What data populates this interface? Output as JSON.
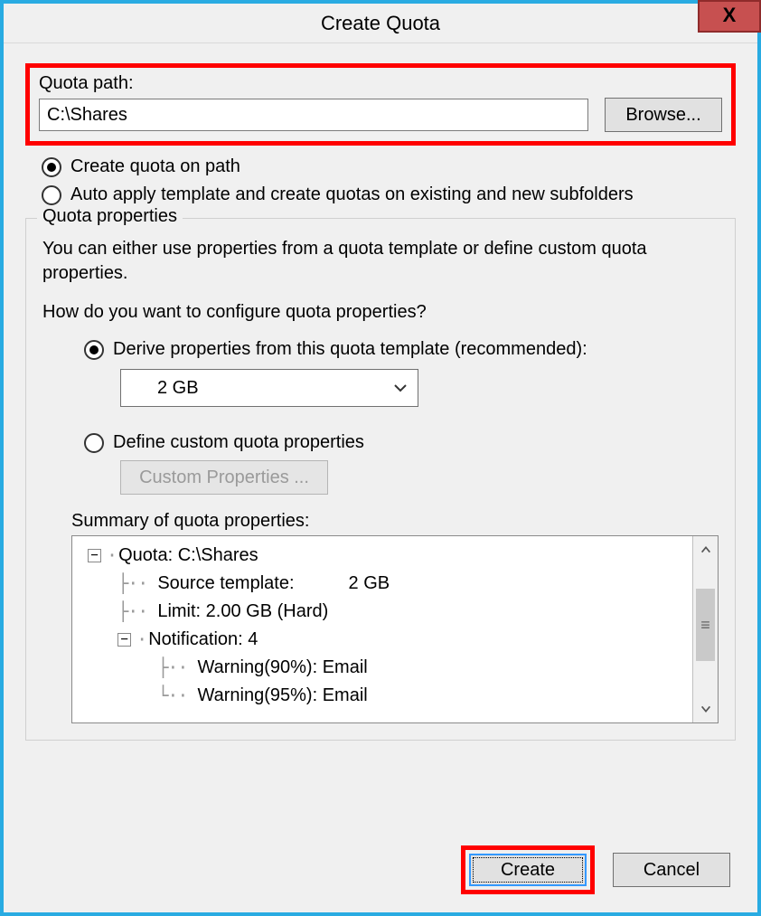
{
  "window": {
    "title": "Create Quota",
    "close_glyph": "X"
  },
  "path": {
    "label": "Quota path:",
    "value": "C:\\Shares",
    "browse_label": "Browse..."
  },
  "radios1": {
    "create_on_path": "Create quota on path",
    "auto_apply": "Auto apply template and create quotas on existing and new subfolders"
  },
  "group": {
    "title": "Quota properties",
    "intro": "You can either use properties from a quota template or define custom quota properties.",
    "question": "How do you want to configure quota properties?",
    "derive_label": "Derive properties from this quota template (recommended):",
    "template_selected": "2 GB",
    "define_custom_label": "Define custom quota properties",
    "custom_btn_label": "Custom Properties ...",
    "summary_label": "Summary of quota properties:",
    "tree": {
      "root": "Quota: C:\\Shares",
      "source_template_label": "Source template:",
      "source_template_value": "2 GB",
      "limit": "Limit: 2.00 GB (Hard)",
      "notification": "Notification: 4",
      "warn90": "Warning(90%): Email",
      "warn95": "Warning(95%): Email"
    }
  },
  "footer": {
    "create": "Create",
    "cancel": "Cancel"
  }
}
